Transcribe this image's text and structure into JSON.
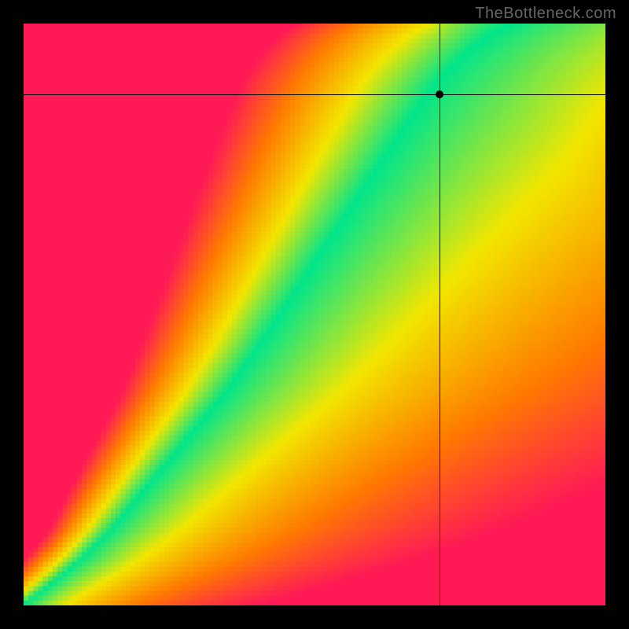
{
  "watermark": "TheBottleneck.com",
  "chart_data": {
    "type": "heatmap",
    "title": "",
    "xlabel": "",
    "ylabel": "",
    "xlim": [
      0,
      1
    ],
    "ylim": [
      0,
      1
    ],
    "grid": false,
    "legend": false,
    "crosshair": {
      "x": 0.715,
      "y": 0.878
    },
    "optimal_curve": {
      "description": "narrow ridge of optimal (green) values through the heat field; points are (x, y) in normalized axis coords",
      "points": [
        [
          0.0,
          0.0
        ],
        [
          0.05,
          0.04
        ],
        [
          0.1,
          0.08
        ],
        [
          0.15,
          0.13
        ],
        [
          0.2,
          0.19
        ],
        [
          0.25,
          0.25
        ],
        [
          0.3,
          0.31
        ],
        [
          0.35,
          0.37
        ],
        [
          0.4,
          0.44
        ],
        [
          0.44,
          0.5
        ],
        [
          0.48,
          0.56
        ],
        [
          0.52,
          0.62
        ],
        [
          0.56,
          0.68
        ],
        [
          0.6,
          0.74
        ],
        [
          0.64,
          0.8
        ],
        [
          0.68,
          0.86
        ],
        [
          0.72,
          0.91
        ],
        [
          0.76,
          0.95
        ],
        [
          0.8,
          0.98
        ],
        [
          0.84,
          1.0
        ]
      ]
    },
    "color_scale": [
      {
        "stop": 0.0,
        "color": "#00e58b",
        "meaning": "optimal"
      },
      {
        "stop": 0.35,
        "color": "#f2e600",
        "meaning": "mild"
      },
      {
        "stop": 0.7,
        "color": "#ff7a00",
        "meaning": "moderate"
      },
      {
        "stop": 1.0,
        "color": "#ff1a55",
        "meaning": "severe"
      }
    ],
    "notes": "Field value at any (x, y) equals normalized distance to the optimal_curve ridge; 0 on the ridge, ~1 far from it."
  }
}
